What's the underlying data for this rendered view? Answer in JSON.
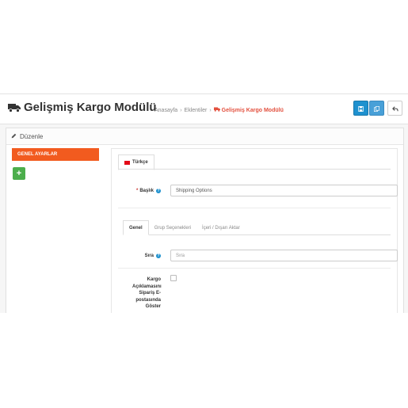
{
  "header": {
    "title": "Gelişmiş Kargo Modülü",
    "breadcrumb": [
      "Anasayfa",
      "Eklentiler",
      "Gelişmiş Kargo Modülü"
    ],
    "breadcrumb_separator": "›",
    "buttons": [
      "save-icon",
      "copy-icon",
      "back-icon"
    ]
  },
  "panel": {
    "heading": "Düzenle",
    "side_tab": "GENEL AYARLAR",
    "add_label": "+"
  },
  "form": {
    "lang_tab": "Türkçe",
    "title_label": "Başlık",
    "title_required": "*",
    "title_value": "Shipping Options",
    "help": "?",
    "tabs": [
      "Genel",
      "Grup Seçenekleri",
      "İçeri / Dışarı Aktar"
    ],
    "sort_label": "Sıra",
    "sort_placeholder": "Sıra",
    "email_label": "Kargo Açıklamasını Sipariş E-postasında Göster"
  },
  "colors": {
    "accent_orange": "#f25b1f",
    "primary_blue": "#1e91cf",
    "success_green": "#4cae4c",
    "breadcrumb_active": "#e3503e"
  }
}
